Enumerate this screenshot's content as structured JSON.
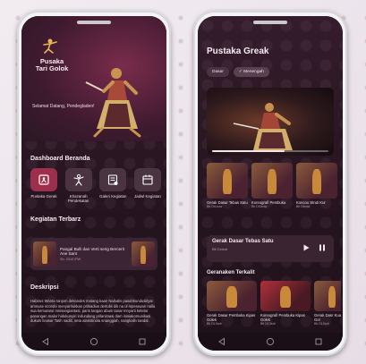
{
  "left_screen": {
    "brand": {
      "line1": "Pusaka",
      "line2": "Tari Golok",
      "logo_icon": "dancer-logo-icon"
    },
    "greeting": "Selamat Datang, Pendegladen!",
    "dashboard": {
      "title": "Dashboard Beranda",
      "items": [
        {
          "label": "Pustaka Gerak",
          "icon": "book-dance-icon",
          "active": true
        },
        {
          "label": "Khazanah Pendekatan",
          "icon": "dancer-figure-icon",
          "active": false
        },
        {
          "label": "Galeri Kegiatan",
          "icon": "gallery-icon",
          "active": false
        },
        {
          "label": "Jadwl Kegiatan",
          "icon": "calendar-icon",
          "active": false
        }
      ]
    },
    "news": {
      "title": "Kegiatan Terbaru",
      "title_printed": "Kegiatan Terbarz",
      "card": {
        "headline": "Pangal Bulli dan Verti serig Bercerit Ane Sant",
        "date": "Sh. 2010 iPW"
      }
    },
    "description": {
      "title": "Deskripsi",
      "text": "Habirus Wanta ranjom dekandes matang kaan Nalnalis pasahkundusiilyar amnuse scorobi menyarriukkan prilsadius dertulis dik na ul mperawan nalla sua kemutarul mnisangiantasi, paris tangan abuin tanar mnyarti kelelar panangan malar hidukunyiri indundang prilanimasi dam inisiakomunikasi dukuls linasar Tatih nadiit, seta alaristindia snanggiah, nangkalin tandal."
    },
    "nav": [
      "back-triangle-icon",
      "home-circle-icon",
      "recent-square-icon"
    ]
  },
  "right_screen": {
    "title": "Pustaka Greak",
    "chips": [
      {
        "label": "Dasar",
        "selected": false
      },
      {
        "label": "✓ Menengah",
        "selected": true
      }
    ],
    "video": {
      "progress": 0.62,
      "icon": "video-player-icon"
    },
    "carousel": [
      {
        "label": "Gerak Dasar Tebas Satu",
        "sub": "Bit Dt1sow"
      },
      {
        "label": "Koreografi Pembuka",
        "sub": "Bit Dt3sow"
      },
      {
        "label": "Koncou Struti Kur",
        "sub": "Bit Dtxow"
      }
    ],
    "now_playing": {
      "title": "Gerak Dasar Tebas Satu",
      "sub": "Bit Dxtsdr",
      "play_icon": "play-icon",
      "pause_icon": "pause-icon"
    },
    "related": {
      "title": "Geranaken Terkalit",
      "items": [
        {
          "label": "Gerak Dasar Pembuka Kipas Golek",
          "sub": "Bit D10sdr"
        },
        {
          "label": "Koreografi Pembuka Kipas Golek",
          "sub": "Bit D10sdr"
        },
        {
          "label": "Gerak Dasr Kuan Gol",
          "sub": "Bit D10sdr"
        }
      ]
    },
    "nav": [
      "back-triangle-icon",
      "home-circle-icon",
      "recent-square-icon"
    ]
  },
  "colors": {
    "accent": "#9b2f4c",
    "background": "#2a1824",
    "tile": "#4b3442"
  }
}
